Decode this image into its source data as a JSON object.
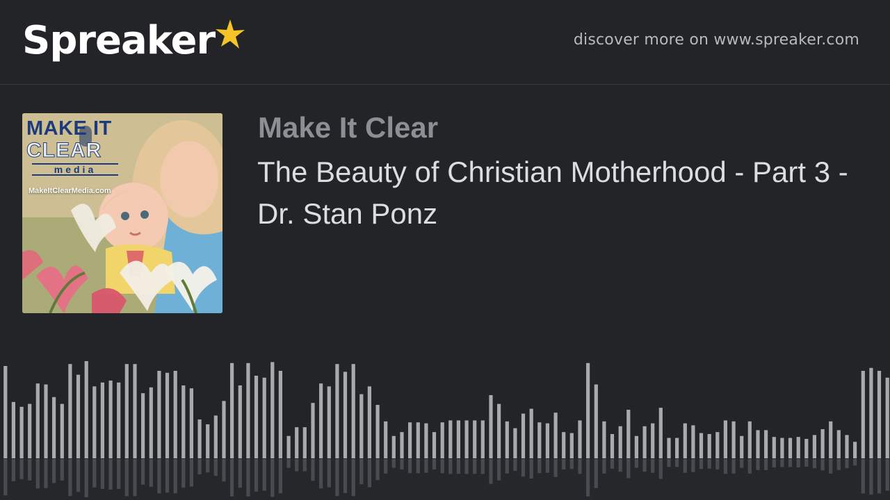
{
  "header": {
    "logo_text": "Spreaker",
    "discover_text": "discover more on www.spreaker.com"
  },
  "cover": {
    "brand_line1": "MAKE IT",
    "brand_line2": "CLEAR",
    "brand_line3": "media",
    "url_text": "MakeItClearMedia.com"
  },
  "episode": {
    "show_name": "Make It Clear",
    "title": "The Beauty of Christian Motherhood - Part 3 - Dr. Stan Ponz"
  },
  "waveform": {
    "played_fraction": 0,
    "levels": [
      0.95,
      0.58,
      0.53,
      0.56,
      0.77,
      0.76,
      0.63,
      0.56,
      0.97,
      0.86,
      1.0,
      0.74,
      0.78,
      0.8,
      0.78,
      0.97,
      0.97,
      0.67,
      0.73,
      0.9,
      0.88,
      0.9,
      0.75,
      0.72,
      0.4,
      0.35,
      0.44,
      0.59,
      0.98,
      0.75,
      0.98,
      0.85,
      0.83,
      0.99,
      0.9,
      0.23,
      0.32,
      0.32,
      0.57,
      0.77,
      0.74,
      0.97,
      0.89,
      0.97,
      0.66,
      0.74,
      0.55,
      0.38,
      0.23,
      0.27,
      0.37,
      0.37,
      0.36,
      0.27,
      0.37,
      0.39,
      0.39,
      0.39,
      0.39,
      0.39,
      0.65,
      0.56,
      0.38,
      0.31,
      0.46,
      0.51,
      0.37,
      0.36,
      0.47,
      0.27,
      0.26,
      0.39,
      0.98,
      0.76,
      0.38,
      0.25,
      0.33,
      0.5,
      0.23,
      0.33,
      0.36,
      0.52,
      0.21,
      0.21,
      0.36,
      0.34,
      0.26,
      0.25,
      0.27,
      0.39,
      0.38,
      0.23,
      0.38,
      0.29,
      0.29,
      0.22,
      0.21,
      0.21,
      0.22,
      0.2,
      0.24,
      0.3,
      0.38,
      0.29,
      0.24,
      0.17,
      0.9,
      0.93,
      0.9,
      0.83
    ]
  }
}
